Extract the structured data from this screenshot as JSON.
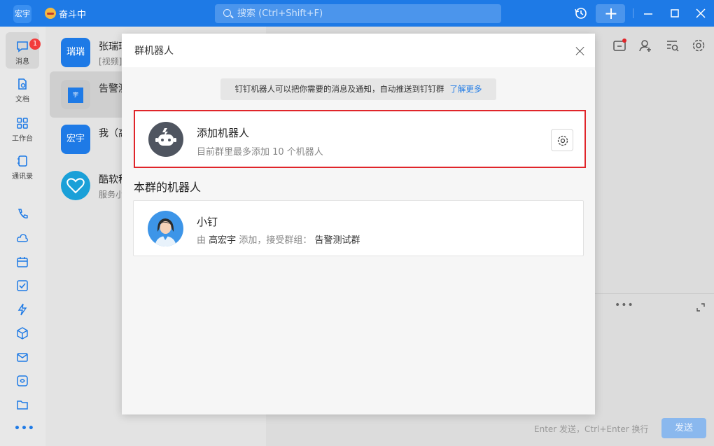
{
  "titlebar": {
    "avatar_text": "宏宇",
    "status_text": "奋斗中",
    "search_placeholder": "搜索 (Ctrl+Shift+F)",
    "icons": [
      "history-icon",
      "plus-icon",
      "minimize-icon",
      "maximize-icon",
      "close-icon"
    ]
  },
  "leftnav": {
    "items": [
      {
        "label": "消息",
        "icon": "chat-icon",
        "badge": "1",
        "active": true
      },
      {
        "label": "文档",
        "icon": "document-icon"
      },
      {
        "label": "工作台",
        "icon": "apps-icon"
      },
      {
        "label": "通讯录",
        "icon": "contacts-icon"
      }
    ],
    "more": "•••"
  },
  "conversations": [
    {
      "avatar": "瑞瑞",
      "title": "张瑞瑞",
      "sub": "[视频]",
      "color": "#1e7ae6"
    },
    {
      "avatar": "宇",
      "title": "告警测试群",
      "sub": "",
      "color": "#1e7ae6",
      "active": true
    },
    {
      "avatar": "宏宇",
      "title": "我（高宏宇）",
      "sub": "",
      "color": "#1e7ae6"
    },
    {
      "avatar": "",
      "title": "酷软科技",
      "sub": "服务小助手",
      "color": "#1aa0d8"
    }
  ],
  "chat": {
    "input_hint": "Enter 发送，Ctrl+Enter 换行",
    "send_label": "发送",
    "more_label": "•••"
  },
  "modal": {
    "title": "群机器人",
    "tip_text": "钉钉机器人可以把你需要的消息及通知，自动推送到钉钉群",
    "tip_link": "了解更多",
    "add_title": "添加机器人",
    "add_sub": "目前群里最多添加 10 个机器人",
    "section_title": "本群的机器人",
    "bot": {
      "name": "小钉",
      "sub_prefix": "由",
      "creator": "高宏宇",
      "sub_mid": "添加，接受群组：",
      "group": "告警测试群"
    }
  },
  "colors": {
    "accent": "#1e7ae6",
    "highlight": "#e0252a"
  }
}
